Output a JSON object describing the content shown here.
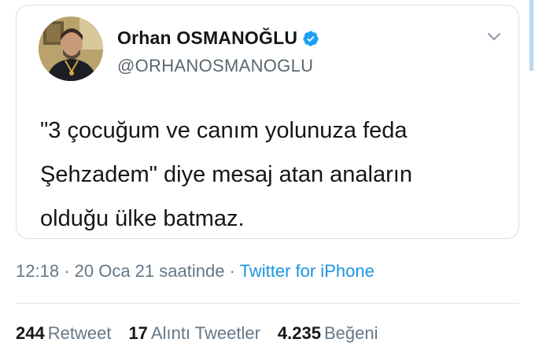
{
  "author": {
    "display_name": "Orhan OSMANOĞLU",
    "handle": "@ORHANOSMANOGLU",
    "verified_icon": "verified-badge-icon",
    "avatar_icon": "profile-photo"
  },
  "tweet": {
    "text": "\"3 çocuğum ve canım yolunuza feda\nŞehzadem\" diye mesaj atan anaların\nolduğu ülke batmaz."
  },
  "meta": {
    "time": "12:18",
    "separator": "·",
    "date": "20 Oca 21 saatinde",
    "separator2": "·",
    "source": "Twitter for iPhone"
  },
  "stats": {
    "retweets_count": "244",
    "retweets_label": "Retweet",
    "quotes_count": "17",
    "quotes_label": "Alıntı Tweetler",
    "likes_count": "4.235",
    "likes_label": "Beğeni"
  },
  "colors": {
    "accent": "#1b95e0",
    "secondary_text": "#657786",
    "primary_text": "#14171a"
  }
}
